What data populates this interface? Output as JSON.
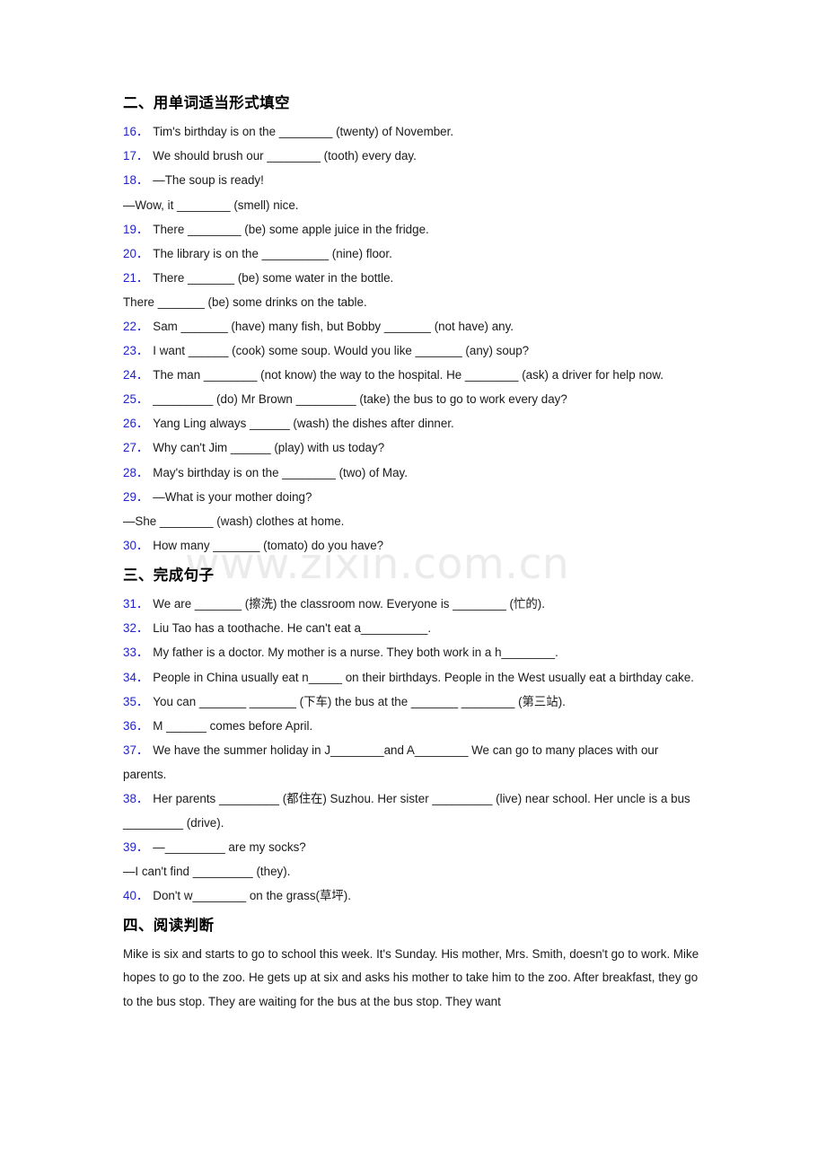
{
  "document": {
    "watermark": "www.zixin.com.cn",
    "accent_color": "#2222cc",
    "text_color": "#1a1a1a",
    "background_color": "#ffffff"
  },
  "sections": [
    {
      "id": "section-two",
      "heading": "二、用单词适当形式填空",
      "items": [
        {
          "num": "16",
          "text": "Tim's birthday is on the ________ (twenty) of November."
        },
        {
          "num": "17",
          "text": "We should brush our ________ (tooth) every day."
        },
        {
          "num": "18",
          "text": "—The soup is ready!",
          "cont": [
            "—Wow, it ________ (smell) nice."
          ]
        },
        {
          "num": "19",
          "text": "There ________ (be) some apple juice in the fridge."
        },
        {
          "num": "20",
          "text": "The library is on the __________ (nine) floor."
        },
        {
          "num": "21",
          "text": "There _______ (be) some water in the bottle.",
          "cont": [
            "There _______ (be) some drinks on the table."
          ]
        },
        {
          "num": "22",
          "text": "Sam _______ (have) many fish, but Bobby _______ (not have) any."
        },
        {
          "num": "23",
          "text": "I want ______ (cook) some soup. Would you like _______ (any) soup?"
        },
        {
          "num": "24",
          "text": "The man ________ (not know) the way to the hospital. He ________ (ask) a driver for help now."
        },
        {
          "num": "25",
          "text": "_________ (do) Mr Brown _________ (take) the bus to go to work every day?"
        },
        {
          "num": "26",
          "text": "Yang Ling always ______ (wash) the dishes after dinner."
        },
        {
          "num": "27",
          "text": "Why can't Jim ______ (play) with us today?"
        },
        {
          "num": "28",
          "text": "May's birthday is on the ________ (two) of May."
        },
        {
          "num": "29",
          "text": "—What is your mother doing?",
          "cont": [
            "—She ________ (wash) clothes at home."
          ]
        },
        {
          "num": "30",
          "text": "How many _______ (tomato) do you have?"
        }
      ]
    },
    {
      "id": "section-three",
      "heading": "三、完成句子",
      "items": [
        {
          "num": "31",
          "text": "We are _______ (擦洗) the classroom now. Everyone is ________ (忙的)."
        },
        {
          "num": "32",
          "text": "Liu Tao has a toothache. He can't eat a__________."
        },
        {
          "num": "33",
          "text": "My father is a doctor. My mother is a nurse. They both work in a h________."
        },
        {
          "num": "34",
          "text": "People in China usually eat n_____ on their birthdays. People in the West usually eat a birthday cake."
        },
        {
          "num": "35",
          "text": "You can _______ _______ (下车) the bus at the _______ ________ (第三站)."
        },
        {
          "num": "36",
          "text": "M ______ comes before April."
        },
        {
          "num": "37",
          "text": "We have the summer holiday in J________and A________ We can go to many places with our parents."
        },
        {
          "num": "38",
          "text": "Her parents _________ (都住在) Suzhou. Her sister _________ (live) near school. Her uncle is a bus _________ (drive)."
        },
        {
          "num": "39",
          "text": "—_________ are my socks?",
          "cont": [
            "—I can't find _________ (they)."
          ]
        },
        {
          "num": "40",
          "text": "Don't w________ on the grass(草坪)."
        }
      ]
    },
    {
      "id": "section-four",
      "heading": "四、阅读判断",
      "passage": "Mike is six and starts to go to school this week. It's Sunday. His mother, Mrs. Smith, doesn't go to work. Mike hopes to go to the zoo. He gets up at six and asks his mother to take him to the zoo. After breakfast, they go to the bus stop. They are waiting for the bus at the bus stop. They want"
    }
  ]
}
